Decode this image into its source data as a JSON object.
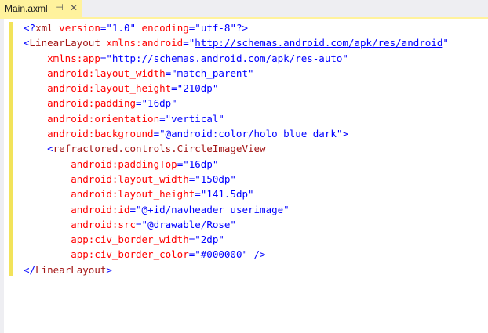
{
  "tab": {
    "title": "Main.axml",
    "pin_icon": "pin-icon",
    "close_icon": "close-icon"
  },
  "colors": {
    "tab_background": "#fff29d",
    "change_margin": "#f2e35a",
    "xml_delimiter": "#0000ff",
    "xml_tag": "#a31515",
    "xml_attribute": "#ff0000",
    "xml_value": "#0000ff"
  },
  "code": [
    [
      {
        "t": "<?",
        "c": "blue"
      },
      {
        "t": "xml",
        "c": "brown"
      },
      {
        "t": " ",
        "c": "plain"
      },
      {
        "t": "version",
        "c": "red"
      },
      {
        "t": "=\"1.0\" ",
        "c": "blue"
      },
      {
        "t": "encoding",
        "c": "red"
      },
      {
        "t": "=\"utf-8\"?>",
        "c": "blue"
      }
    ],
    [
      {
        "t": "<",
        "c": "blue"
      },
      {
        "t": "LinearLayout",
        "c": "brown"
      },
      {
        "t": " ",
        "c": "plain"
      },
      {
        "t": "xmlns:android",
        "c": "red"
      },
      {
        "t": "=\"",
        "c": "blue"
      },
      {
        "t": "http://schemas.android.com/apk/res/android",
        "c": "link"
      },
      {
        "t": "\"",
        "c": "blue"
      }
    ],
    [
      {
        "t": "    ",
        "c": "plain"
      },
      {
        "t": "xmlns:app",
        "c": "red"
      },
      {
        "t": "=\"",
        "c": "blue"
      },
      {
        "t": "http://schemas.android.com/apk/res-auto",
        "c": "link"
      },
      {
        "t": "\"",
        "c": "blue"
      }
    ],
    [
      {
        "t": "    ",
        "c": "plain"
      },
      {
        "t": "android:layout_width",
        "c": "red"
      },
      {
        "t": "=\"match_parent\"",
        "c": "blue"
      }
    ],
    [
      {
        "t": "    ",
        "c": "plain"
      },
      {
        "t": "android:layout_height",
        "c": "red"
      },
      {
        "t": "=\"210dp\"",
        "c": "blue"
      }
    ],
    [
      {
        "t": "    ",
        "c": "plain"
      },
      {
        "t": "android:padding",
        "c": "red"
      },
      {
        "t": "=\"16dp\"",
        "c": "blue"
      }
    ],
    [
      {
        "t": "    ",
        "c": "plain"
      },
      {
        "t": "android:orientation",
        "c": "red"
      },
      {
        "t": "=\"vertical\"",
        "c": "blue"
      }
    ],
    [
      {
        "t": "    ",
        "c": "plain"
      },
      {
        "t": "android:background",
        "c": "red"
      },
      {
        "t": "=\"@android:color/holo_blue_dark\">",
        "c": "blue"
      }
    ],
    [
      {
        "t": "    <",
        "c": "blue"
      },
      {
        "t": "refractored.controls.CircleImageView",
        "c": "brown"
      }
    ],
    [
      {
        "t": "        ",
        "c": "plain"
      },
      {
        "t": "android:paddingTop",
        "c": "red"
      },
      {
        "t": "=\"16dp\"",
        "c": "blue"
      }
    ],
    [
      {
        "t": "        ",
        "c": "plain"
      },
      {
        "t": "android:layout_width",
        "c": "red"
      },
      {
        "t": "=\"150dp\"",
        "c": "blue"
      }
    ],
    [
      {
        "t": "        ",
        "c": "plain"
      },
      {
        "t": "android:layout_height",
        "c": "red"
      },
      {
        "t": "=\"141.5dp\"",
        "c": "blue"
      }
    ],
    [
      {
        "t": "        ",
        "c": "plain"
      },
      {
        "t": "android:id",
        "c": "red"
      },
      {
        "t": "=\"@+id/navheader_userimage\"",
        "c": "blue"
      }
    ],
    [
      {
        "t": "        ",
        "c": "plain"
      },
      {
        "t": "android:src",
        "c": "red"
      },
      {
        "t": "=\"@drawable/Rose\"",
        "c": "blue"
      }
    ],
    [
      {
        "t": "        ",
        "c": "plain"
      },
      {
        "t": "app:civ_border_width",
        "c": "red"
      },
      {
        "t": "=\"2dp\"",
        "c": "blue"
      }
    ],
    [
      {
        "t": "        ",
        "c": "plain"
      },
      {
        "t": "app:civ_border_color",
        "c": "red"
      },
      {
        "t": "=\"#000000\" />",
        "c": "blue"
      }
    ],
    [
      {
        "t": "</",
        "c": "blue"
      },
      {
        "t": "LinearLayout",
        "c": "brown"
      },
      {
        "t": ">",
        "c": "blue"
      }
    ]
  ]
}
